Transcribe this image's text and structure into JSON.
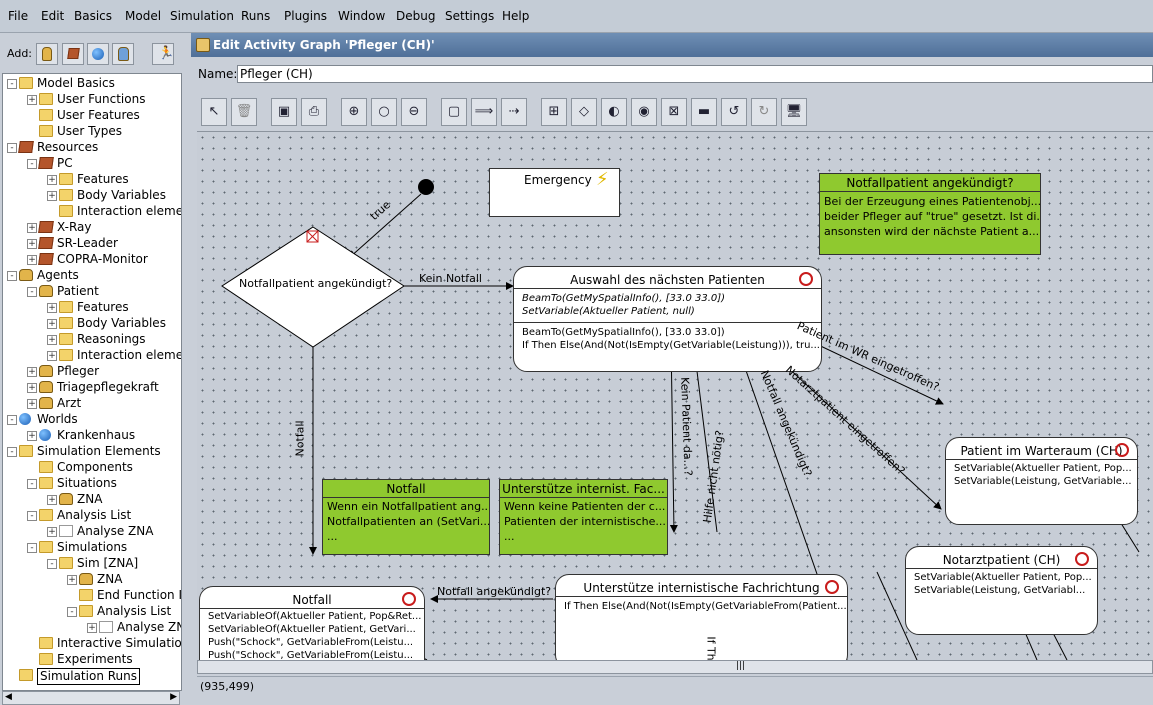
{
  "menu": [
    "File",
    "Edit",
    "Basics",
    "Model",
    "Simulation",
    "Runs",
    "Plugins",
    "Window",
    "Debug",
    "Settings",
    "Help"
  ],
  "left": {
    "add_label": "Add:",
    "tree": [
      {
        "label": "Model Basics",
        "icon": "folder-icon",
        "level": 0,
        "exp": "-"
      },
      {
        "label": "User Functions",
        "icon": "folder-icon",
        "level": 1,
        "exp": "+"
      },
      {
        "label": "User Features",
        "icon": "folder-icon",
        "level": 1,
        "exp": ""
      },
      {
        "label": "User Types",
        "icon": "folder-icon",
        "level": 1,
        "exp": ""
      },
      {
        "label": "Resources",
        "icon": "cube-icon",
        "level": 0,
        "exp": "-"
      },
      {
        "label": "PC",
        "icon": "cube-icon",
        "level": 1,
        "exp": "-"
      },
      {
        "label": "Features",
        "icon": "folder-icon",
        "level": 2,
        "exp": "+"
      },
      {
        "label": "Body Variables",
        "icon": "folder-icon",
        "level": 2,
        "exp": "+"
      },
      {
        "label": "Interaction elemen",
        "icon": "folder-icon",
        "level": 2,
        "exp": ""
      },
      {
        "label": "X-Ray",
        "icon": "cube-icon",
        "level": 1,
        "exp": "+"
      },
      {
        "label": "SR-Leader",
        "icon": "cube-icon",
        "level": 1,
        "exp": "+"
      },
      {
        "label": "COPRA-Monitor",
        "icon": "cube-icon",
        "level": 1,
        "exp": "+"
      },
      {
        "label": "Agents",
        "icon": "agent-icon",
        "level": 0,
        "exp": "-"
      },
      {
        "label": "Patient",
        "icon": "agent-icon",
        "level": 1,
        "exp": "-"
      },
      {
        "label": "Features",
        "icon": "folder-icon",
        "level": 2,
        "exp": "+"
      },
      {
        "label": "Body Variables",
        "icon": "folder-icon",
        "level": 2,
        "exp": "+"
      },
      {
        "label": "Reasonings",
        "icon": "folder-icon",
        "level": 2,
        "exp": "+"
      },
      {
        "label": "Interaction elemen",
        "icon": "folder-icon",
        "level": 2,
        "exp": "+"
      },
      {
        "label": "Pfleger",
        "icon": "agent-icon",
        "level": 1,
        "exp": "+"
      },
      {
        "label": "Triagepflegekraft",
        "icon": "agent-icon",
        "level": 1,
        "exp": "+"
      },
      {
        "label": "Arzt",
        "icon": "agent-icon",
        "level": 1,
        "exp": "+"
      },
      {
        "label": "Worlds",
        "icon": "globe-icon",
        "level": 0,
        "exp": "-"
      },
      {
        "label": "Krankenhaus",
        "icon": "globe-icon",
        "level": 1,
        "exp": "+"
      },
      {
        "label": "Simulation Elements",
        "icon": "folder-icon",
        "level": 0,
        "exp": "-"
      },
      {
        "label": "Components",
        "icon": "folder-icon",
        "level": 1,
        "exp": ""
      },
      {
        "label": "Situations",
        "icon": "folder-icon",
        "level": 1,
        "exp": "-"
      },
      {
        "label": "ZNA",
        "icon": "agent-icon",
        "level": 2,
        "exp": "+"
      },
      {
        "label": "Analysis List",
        "icon": "folder-icon",
        "level": 1,
        "exp": "-"
      },
      {
        "label": "Analyse ZNA",
        "icon": "chart-icon",
        "level": 2,
        "exp": "+"
      },
      {
        "label": "Simulations",
        "icon": "folder-icon",
        "level": 1,
        "exp": "-"
      },
      {
        "label": "Sim [ZNA]",
        "icon": "folder-icon",
        "level": 2,
        "exp": "-"
      },
      {
        "label": "ZNA",
        "icon": "agent-icon",
        "level": 3,
        "exp": "+"
      },
      {
        "label": "End Function I",
        "icon": "folder-icon",
        "level": 3,
        "exp": ""
      },
      {
        "label": "Analysis List",
        "icon": "folder-icon",
        "level": 3,
        "exp": "-"
      },
      {
        "label": "Analyse ZN",
        "icon": "chart-icon",
        "level": 4,
        "exp": "+"
      },
      {
        "label": "Interactive Simulation",
        "icon": "folder-icon",
        "level": 1,
        "exp": ""
      },
      {
        "label": "Experiments",
        "icon": "folder-icon",
        "level": 1,
        "exp": ""
      },
      {
        "label": "Simulation Runs",
        "icon": "folder-icon",
        "level": 0,
        "exp": ""
      }
    ]
  },
  "editor": {
    "title": "Edit Activity Graph 'Pfleger (CH)'",
    "name_label": "Name:",
    "name_value": "Pfleger (CH)",
    "status": "(935,499)"
  },
  "graph": {
    "emergency": "Emergency",
    "decision": "Notfallpatient angekündigt?",
    "auswahl": {
      "title": "Auswahl des nächsten Patienten",
      "lines_italic": [
        "BeamTo(GetMySpatialInfo(), [33.0 33.0])",
        "SetVariable(Aktueller Patient, null)"
      ],
      "lines": [
        "BeamTo(GetMySpatialInfo(), [33.0 33.0])",
        "If Then Else(And(Not(IsEmpty(GetVariable(Leistung))), tru..."
      ]
    },
    "warteraum": {
      "title": "Patient im Warteraum (CH)",
      "lines": [
        "SetVariable(Aktueller Patient, Pop...",
        "SetVariable(Leistung, GetVariable..."
      ]
    },
    "notarzt": {
      "title": "Notarztpatient (CH)",
      "lines": [
        "SetVariable(Aktueller Patient, Pop...",
        "SetVariable(Leistung, GetVariabl..."
      ]
    },
    "unterstuetze": {
      "title": "Unterstütze internistische Fachrichtung",
      "lines": [
        "If Then Else(And(Not(IsEmpty(GetVariableFrom(Patient..."
      ]
    },
    "notfall": {
      "title": "Notfall",
      "lines": [
        "SetVariableOf(Aktueller Patient, Pop&Ret...",
        "SetVariableOf(Aktueller Patient, GetVari...",
        "Push(\"Schock\", GetVariableFrom(Leistu...",
        "Push(\"Schock\", GetVariableFrom(Leistu..."
      ]
    },
    "note1": {
      "title": "Notfallpatient angekündigt?",
      "lines": [
        "Bei der Erzeugung eines Patientenobj...",
        "beider Pfleger auf \"true\" gesetzt. Ist di...",
        "ansonsten wird der nächste Patient a..."
      ]
    },
    "note2": {
      "title": "Notfall",
      "lines": [
        "Wenn ein Notfallpatient ang...",
        "Notfallpatienten an (SetVari...",
        "..."
      ]
    },
    "note3": {
      "title": "Unterstütze internist. Fac...",
      "lines": [
        "Wenn keine Patienten der c...",
        "Patienten der internistische...",
        "..."
      ]
    },
    "edges": {
      "true": "true",
      "kein_notfall": "Kein Notfall",
      "notfall": "Notfall",
      "kein_patient": "Kein Patient da...?",
      "hilfe": "Hilfe nicht nötig?",
      "notfall_angekuendigt_diag": "Notfall angekündigt?",
      "notarzt_eingetroffen": "Notarztpatient eingetroffen?",
      "patient_wr": "Patient im WR eingetroffen?",
      "notfall_angekuendigt": "Notfall angekündigt?",
      "if_th": "If Th"
    }
  },
  "colors": {
    "note": "#8fc92f",
    "alarm": "#c81c1c",
    "titlebar": "#5a7aa3"
  }
}
